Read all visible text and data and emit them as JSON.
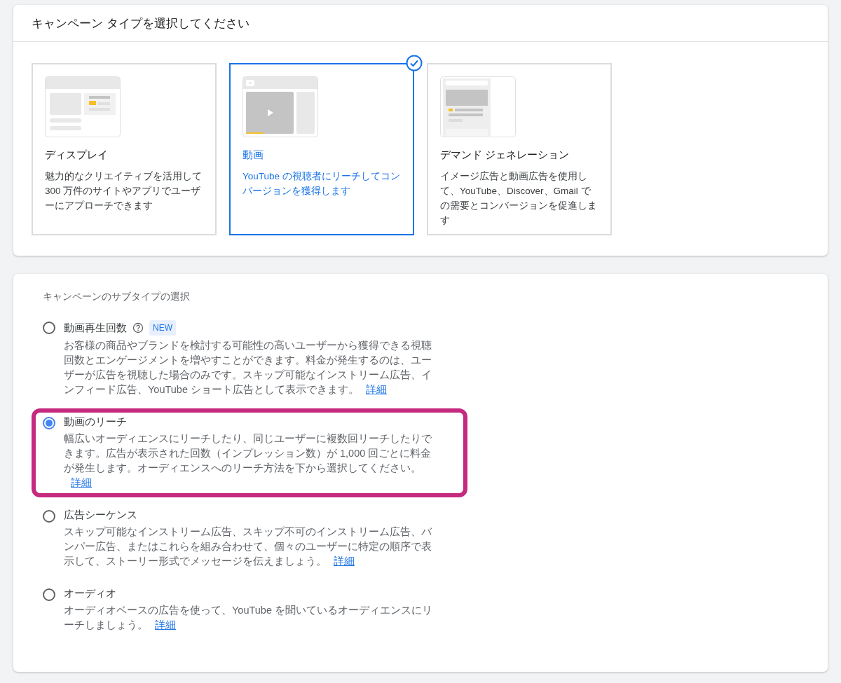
{
  "campaign_type": {
    "title": "キャンペーン タイプを選択してください",
    "cards": [
      {
        "kind": "display",
        "title": "ディスプレイ",
        "description": "魅力的なクリエイティブを活用して 300 万件のサイトやアプリでユーザーにアプローチできます",
        "selected": false
      },
      {
        "kind": "video",
        "title": "動画",
        "description": "YouTube の視聴者にリーチしてコンバージョンを獲得します",
        "selected": true
      },
      {
        "kind": "demand_gen",
        "title": "デマンド ジェネレーション",
        "description": "イメージ広告と動画広告を使用して、YouTube、Discover、Gmail での需要とコンバージョンを促進します",
        "selected": false
      }
    ]
  },
  "subtype": {
    "heading": "キャンペーンのサブタイプの選択",
    "options": [
      {
        "label": "動画再生回数",
        "help": true,
        "badge": "NEW",
        "selected": false,
        "highlighted": false,
        "description": "お客様の商品やブランドを検討する可能性の高いユーザーから獲得できる視聴回数とエンゲージメントを増やすことができます。料金が発生するのは、ユーザーが広告を視聴した場合のみです。スキップ可能なインストリーム広告、インフィード広告、YouTube ショート広告として表示できます。",
        "link": "詳細"
      },
      {
        "label": "動画のリーチ",
        "help": false,
        "selected": true,
        "highlighted": true,
        "description": "幅広いオーディエンスにリーチしたり、同じユーザーに複数回リーチしたりできます。広告が表示された回数（インプレッション数）が 1,000 回ごとに料金が発生します。オーディエンスへのリーチ方法を下から選択してください。",
        "link": "詳細"
      },
      {
        "label": "広告シーケンス",
        "help": false,
        "selected": false,
        "highlighted": false,
        "description": "スキップ可能なインストリーム広告、スキップ不可のインストリーム広告、バンパー広告、またはこれらを組み合わせて、個々のユーザーに特定の順序で表示して、ストーリー形式でメッセージを伝えましょう。",
        "link": "詳細"
      },
      {
        "label": "オーディオ",
        "help": false,
        "selected": false,
        "highlighted": false,
        "description": "オーディオベースの広告を使って、YouTube を聞いているオーディエンスにリーチしましょう。",
        "link": "詳細"
      }
    ]
  }
}
